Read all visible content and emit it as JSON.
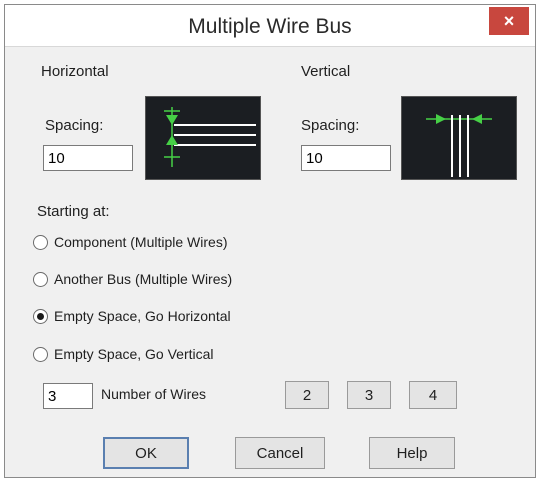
{
  "window": {
    "title": "Multiple Wire Bus",
    "close_glyph": "×"
  },
  "horizontal": {
    "section_label": "Horizontal",
    "spacing_label": "Spacing:",
    "spacing_value": "10"
  },
  "vertical": {
    "section_label": "Vertical",
    "spacing_label": "Spacing:",
    "spacing_value": "10"
  },
  "starting": {
    "label": "Starting at:",
    "options": [
      {
        "label": "Component (Multiple Wires)",
        "checked": false
      },
      {
        "label": "Another Bus (Multiple Wires)",
        "checked": false
      },
      {
        "label": "Empty Space, Go Horizontal",
        "checked": true
      },
      {
        "label": "Empty Space, Go Vertical",
        "checked": false
      }
    ]
  },
  "wires": {
    "count_value": "3",
    "count_label": "Number of Wires",
    "quick_buttons": [
      "2",
      "3",
      "4"
    ]
  },
  "buttons": {
    "ok": "OK",
    "cancel": "Cancel",
    "help": "Help"
  },
  "colors": {
    "preview_line": "#ffffff",
    "preview_marker": "#46d046",
    "close_bg": "#c8473e"
  }
}
